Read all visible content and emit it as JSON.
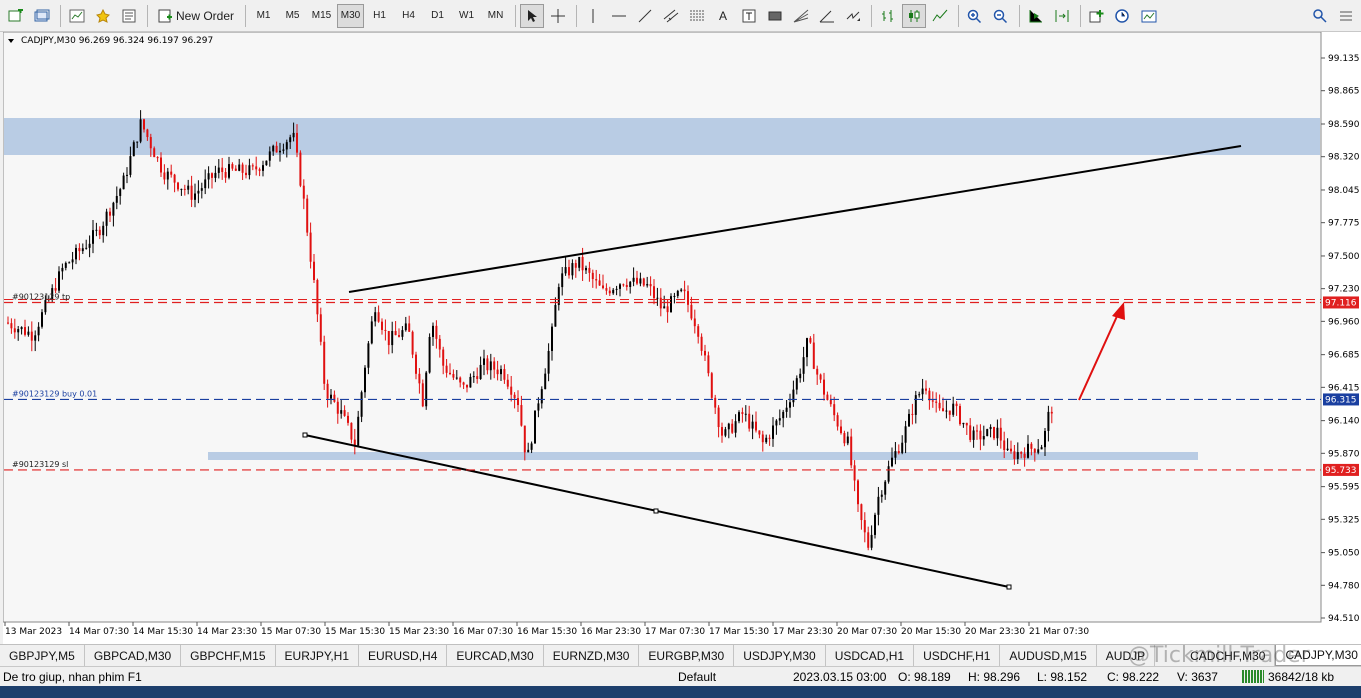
{
  "toolbar": {
    "new_order_label": "New Order",
    "timeframes": [
      "M1",
      "M5",
      "M15",
      "M30",
      "H1",
      "H4",
      "D1",
      "W1",
      "MN"
    ],
    "active_timeframe": "M30"
  },
  "chart": {
    "header": "CADJPY,M30  96.269 96.324 96.197 96.297",
    "price_axis": [
      "99.135",
      "98.865",
      "98.590",
      "98.320",
      "98.045",
      "97.775",
      "97.500",
      "97.230",
      "96.960",
      "96.685",
      "96.415",
      "96.140",
      "95.870",
      "95.595",
      "95.325",
      "95.050",
      "94.780",
      "94.510"
    ],
    "time_axis": [
      "13 Mar 2023",
      "14 Mar 07:30",
      "14 Mar 15:30",
      "14 Mar 23:30",
      "15 Mar 07:30",
      "15 Mar 15:30",
      "15 Mar 23:30",
      "16 Mar 07:30",
      "16 Mar 15:30",
      "16 Mar 23:30",
      "17 Mar 07:30",
      "17 Mar 15:30",
      "17 Mar 23:30",
      "20 Mar 07:30",
      "20 Mar 15:30",
      "20 Mar 23:30",
      "21 Mar 07:30"
    ],
    "order_lines": [
      {
        "label": "#90123129 tp",
        "price": "97.116",
        "color": "#e02020"
      },
      {
        "label": "#90123129 buy 0.01",
        "price": "96.315",
        "color": "#1a3fa0"
      },
      {
        "label": "#90123129 sl",
        "price": "95.733",
        "color": "#e02020"
      }
    ]
  },
  "tabs": [
    "GBPJPY,M5",
    "GBPCAD,M30",
    "GBPCHF,M15",
    "EURJPY,H1",
    "EURUSD,H4",
    "EURCAD,M30",
    "EURNZD,M30",
    "EURGBP,M30",
    "USDJPY,M30",
    "USDCAD,H1",
    "USDCHF,H1",
    "AUDUSD,M15",
    "AUDJP",
    "CADCHF,M30",
    "CADJPY,M30"
  ],
  "active_tab": "CADJPY,M30",
  "status": {
    "help": "De tro giup, nhan phim F1",
    "profile": "Default",
    "datetime": "2023.03.15 03:00",
    "open": "O: 98.189",
    "high": "H: 98.296",
    "low": "L: 98.152",
    "close": "C: 98.222",
    "volume": "V: 3637",
    "traffic": "36842/18 kb"
  },
  "watermark": "@Tickmill Trader",
  "colors": {
    "bull": "#000000",
    "bear": "#e01010",
    "zone": "#b9cce4",
    "tp_sl": "#e02020",
    "entry": "#1a3fa0"
  }
}
